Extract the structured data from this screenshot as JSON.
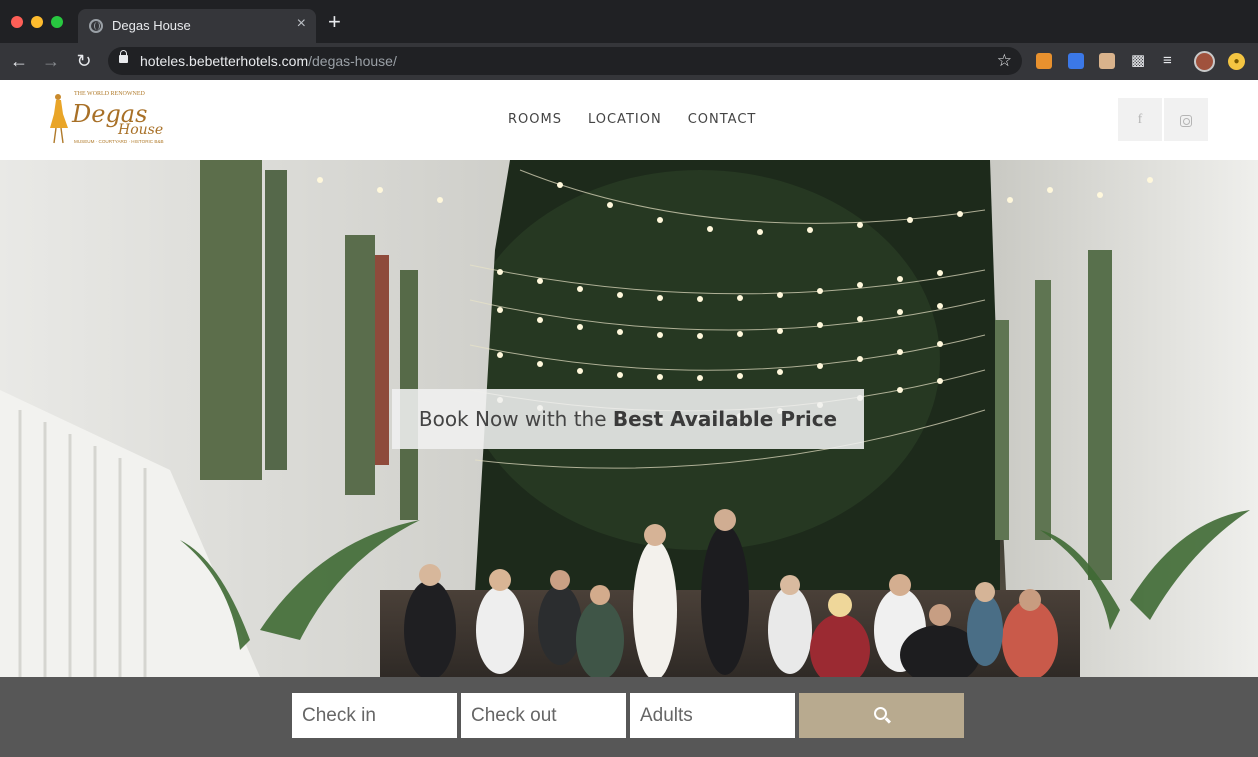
{
  "browser": {
    "tab_title": "Degas House",
    "tab_close": "×",
    "new_tab": "+",
    "url_host": "hoteles.bebetterhotels.com",
    "url_path": "/degas-house/",
    "icons": [
      "back-icon",
      "forward-icon",
      "reload-icon",
      "lock-icon",
      "star-icon",
      "extensions-icon",
      "reading-list-icon",
      "profile-avatar",
      "update-icon"
    ]
  },
  "site": {
    "logo": {
      "top": "THE WORLD RENOWNED",
      "name_1": "Degas",
      "name_2": "House",
      "tagline": "MUSEUM · COURTYARD · HISTORIC B&B"
    },
    "nav": [
      "ROOMS",
      "LOCATION",
      "CONTACT"
    ],
    "social": {
      "facebook": "f"
    },
    "banner": {
      "prefix": "Book Now with the ",
      "bold": "Best Available Price"
    },
    "booking": {
      "check_in": "Check in",
      "check_out": "Check out",
      "adults": "Adults"
    }
  },
  "colors": {
    "booking_bar": "#575757",
    "search_button": "#b8aa8f",
    "logo_gold": "#d89a2e"
  }
}
